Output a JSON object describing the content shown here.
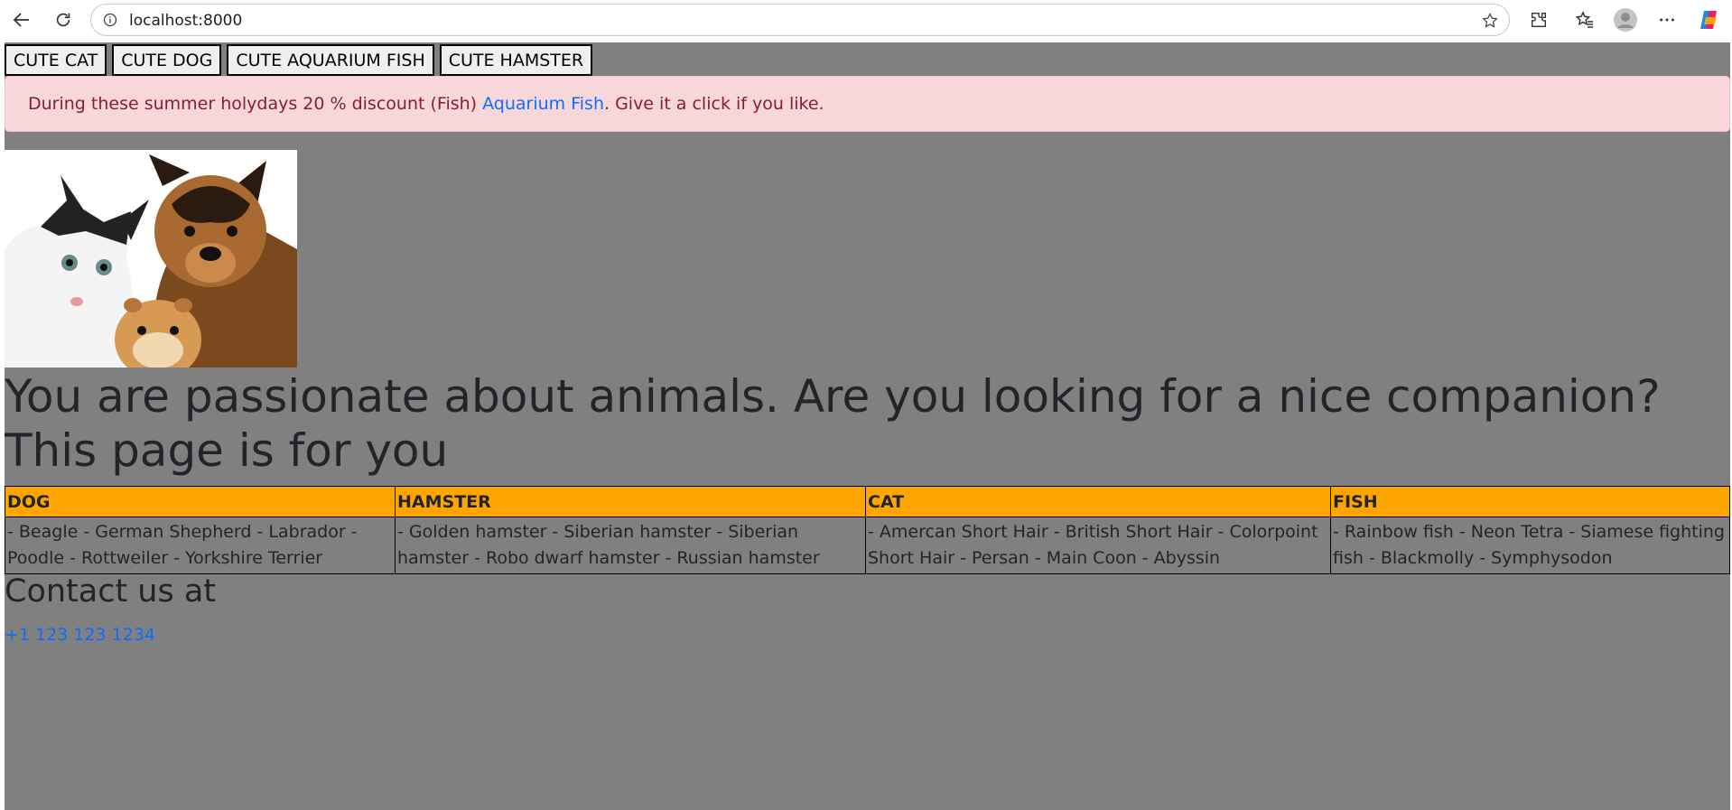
{
  "browser": {
    "url": "localhost:8000",
    "icons": [
      "back-icon",
      "refresh-icon",
      "info-icon",
      "star-icon",
      "extensions-icon",
      "favorites-icon",
      "profile-icon",
      "more-icon",
      "copilot-icon"
    ]
  },
  "nav": {
    "buttons": [
      "CUTE CAT",
      "CUTE DOG",
      "CUTE AQUARIUM FISH",
      "CUTE HAMSTER"
    ]
  },
  "alert": {
    "text_before": "During these summer holydays 20 % discount (Fish) ",
    "link": "Aquarium Fish",
    "text_after": ". Give it a click if you like."
  },
  "headline": "You are passionate about animals. Are you looking for a nice companion? This page is for you",
  "table": {
    "headers": [
      "DOG",
      "HAMSTER",
      "CAT",
      "FISH"
    ],
    "rows": [
      [
        "- Beagle - German Shepherd - Labrador - Poodle - Rottweiler - Yorkshire Terrier",
        "- Golden hamster - Siberian hamster - Siberian hamster - Robo dwarf hamster - Russian hamster",
        "- Amercan Short Hair - British Short Hair - Colorpoint Short Hair - Persan - Main Coon - Abyssin",
        "- Rainbow fish - Neon Tetra - Siamese fighting fish - Blackmolly - Symphysodon"
      ]
    ]
  },
  "contact": {
    "heading": "Contact us at",
    "phone": "+1 123 123 1234"
  },
  "colors": {
    "page_bg": "#808080",
    "table_header": "#ffa500",
    "alert_bg": "#f8d7da",
    "link": "#0d6efd"
  }
}
